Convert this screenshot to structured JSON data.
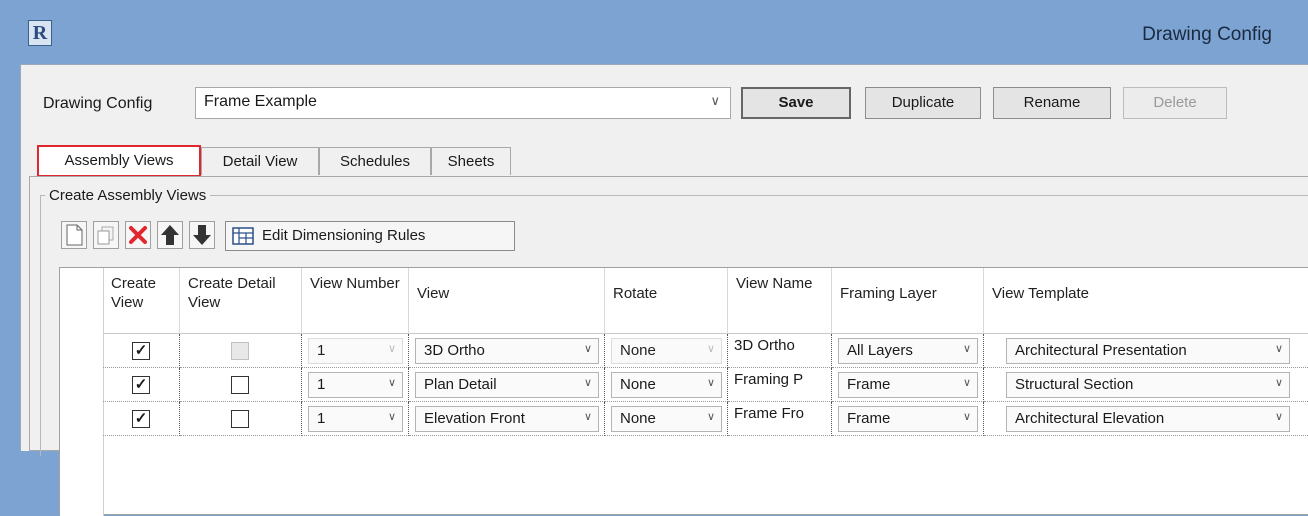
{
  "window": {
    "app_icon_letter": "R",
    "title": "Drawing Config"
  },
  "config_bar": {
    "label": "Drawing Config",
    "selected": "Frame Example",
    "buttons": {
      "save": "Save",
      "duplicate": "Duplicate",
      "rename": "Rename",
      "delete": "Delete"
    }
  },
  "tabs": [
    {
      "label": "Assembly Views",
      "active": true
    },
    {
      "label": "Detail View"
    },
    {
      "label": "Schedules"
    },
    {
      "label": "Sheets"
    }
  ],
  "group_title": "Create Assembly Views",
  "toolbar": {
    "icons": [
      "new-row-icon",
      "copy-row-icon",
      "delete-row-icon",
      "move-up-icon",
      "move-down-icon"
    ],
    "edit_dimensioning_rules": "Edit Dimensioning Rules"
  },
  "table": {
    "columns": {
      "create_view": "Create View",
      "create_detail_view": "Create Detail View",
      "view_number": "View Number",
      "view": "View",
      "rotate": "Rotate",
      "view_name": "View Name",
      "framing_layer": "Framing Layer",
      "view_template": "View Template"
    },
    "rows": [
      {
        "create_view": true,
        "create_detail_view": "disabled",
        "view_number": "1",
        "view": "3D Ortho",
        "rotate": "None",
        "view_name": "3D Ortho",
        "framing_layer": "All Layers",
        "view_template": "Architectural Presentation"
      },
      {
        "create_view": true,
        "create_detail_view": false,
        "view_number": "1",
        "view": "Plan Detail",
        "rotate": "None",
        "view_name": "Framing P",
        "framing_layer": "Frame",
        "view_template": "Structural Section"
      },
      {
        "create_view": true,
        "create_detail_view": false,
        "view_number": "1",
        "view": "Elevation Front",
        "rotate": "None",
        "view_name": "Frame Fro",
        "framing_layer": "Frame",
        "view_template": "Architectural Elevation"
      }
    ]
  },
  "colors": {
    "titlebar": "#7da3d3",
    "active_tab_highlight": "#e0262e",
    "delete_icon": "#e0262e"
  }
}
